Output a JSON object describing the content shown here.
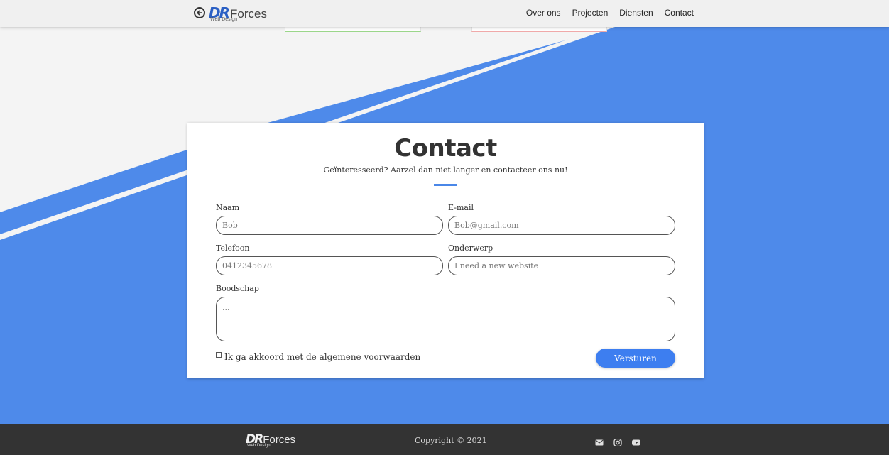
{
  "colors": {
    "accent_blue": "#4e8aea",
    "button_blue": "#3d7ef0",
    "navbar_bg": "#f0f0f0",
    "footer_bg": "#333333",
    "page_bg": "#f4f4f4"
  },
  "navbar": {
    "back_icon": "arrow-left-circle-icon",
    "logo": {
      "mark": "DR",
      "name": "Forces",
      "tagline": "Web Design"
    },
    "links": [
      "Over ons",
      "Projecten",
      "Diensten",
      "Contact"
    ]
  },
  "contact": {
    "title": "Contact",
    "subtitle": "Geïnteresseerd? Aarzel dan niet langer en contacteer ons nu!",
    "fields": {
      "naam": {
        "label": "Naam",
        "placeholder": "Bob"
      },
      "email": {
        "label": "E-mail",
        "placeholder": "Bob@gmail.com"
      },
      "telefoon": {
        "label": "Telefoon",
        "placeholder": "0412345678"
      },
      "onderwerp": {
        "label": "Onderwerp",
        "placeholder": "I need a new website"
      },
      "boodschap": {
        "label": "Boodschap",
        "placeholder": "..."
      }
    },
    "agree_label": "Ik ga akkoord met de algemene voorwaarden",
    "submit_label": "Versturen"
  },
  "footer": {
    "logo": {
      "mark": "DR",
      "name": "Forces",
      "tagline": "Web Design"
    },
    "copyright": "Copyright © 2021",
    "socials": [
      "envelope-icon",
      "instagram-icon",
      "youtube-icon"
    ]
  }
}
